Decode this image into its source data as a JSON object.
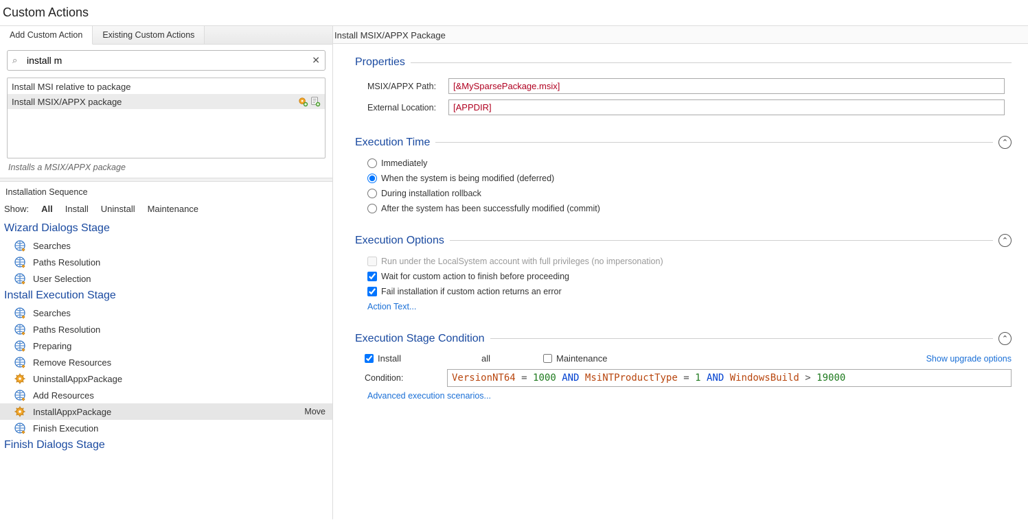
{
  "pageTitle": "Custom Actions",
  "tabs": {
    "add": "Add Custom Action",
    "existing": "Existing Custom Actions"
  },
  "search": {
    "value": "install m",
    "placeholder": ""
  },
  "suggestions": {
    "items": [
      {
        "label": "Install MSI relative to package",
        "selected": false
      },
      {
        "label": "Install MSIX/APPX package",
        "selected": true
      }
    ],
    "hint": "Installs a MSIX/APPX package"
  },
  "seqHeader": "Installation Sequence",
  "showRow": {
    "label": "Show:",
    "options": [
      "All",
      "Install",
      "Uninstall",
      "Maintenance"
    ],
    "active": "All"
  },
  "stages": {
    "wizard": {
      "title": "Wizard Dialogs Stage",
      "items": [
        "Searches",
        "Paths Resolution",
        "User Selection"
      ]
    },
    "exec": {
      "title": "Install Execution Stage",
      "items": [
        {
          "label": "Searches",
          "icon": "globe"
        },
        {
          "label": "Paths Resolution",
          "icon": "globe"
        },
        {
          "label": "Preparing",
          "icon": "globe"
        },
        {
          "label": "Remove Resources",
          "icon": "globe"
        },
        {
          "label": "UninstallAppxPackage",
          "icon": "gear"
        },
        {
          "label": "Add Resources",
          "icon": "globe"
        },
        {
          "label": "InstallAppxPackage",
          "icon": "gear",
          "selected": true,
          "move": "Move"
        },
        {
          "label": "Finish Execution",
          "icon": "globe"
        }
      ]
    },
    "finish": {
      "title": "Finish Dialogs Stage"
    }
  },
  "right": {
    "header": "Install MSIX/APPX Package",
    "sections": {
      "properties": {
        "title": "Properties",
        "pathLabel": "MSIX/APPX Path:",
        "pathValue": "[&MySparsePackage.msix]",
        "extLabel": "External Location:",
        "extValue": "[APPDIR]"
      },
      "execTime": {
        "title": "Execution Time",
        "options": [
          "Immediately",
          "When the system is being modified (deferred)",
          "During installation rollback",
          "After the system has been successfully modified (commit)"
        ],
        "selected": 1
      },
      "execOpts": {
        "title": "Execution Options",
        "optLocal": "Run under the LocalSystem account with full privileges (no impersonation)",
        "optWait": "Wait for custom action to finish before proceeding",
        "optFail": "Fail installation if custom action returns an error",
        "actionText": "Action Text..."
      },
      "stageCond": {
        "title": "Execution Stage Condition",
        "install": "Install",
        "mid": "all",
        "maint": "Maintenance",
        "upgrade": "Show upgrade options",
        "condLabel": "Condition:",
        "cond": {
          "tokens": [
            {
              "t": "var",
              "v": "VersionNT64"
            },
            {
              "t": "sp"
            },
            {
              "t": "op",
              "v": "="
            },
            {
              "t": "sp"
            },
            {
              "t": "num",
              "v": "1000"
            },
            {
              "t": "sp"
            },
            {
              "t": "kw",
              "v": "AND"
            },
            {
              "t": "sp"
            },
            {
              "t": "var",
              "v": "MsiNTProductType"
            },
            {
              "t": "sp"
            },
            {
              "t": "op",
              "v": "="
            },
            {
              "t": "sp"
            },
            {
              "t": "num",
              "v": "1"
            },
            {
              "t": "sp"
            },
            {
              "t": "kw",
              "v": "AND"
            },
            {
              "t": "sp"
            },
            {
              "t": "var",
              "v": "WindowsBuild"
            },
            {
              "t": "sp"
            },
            {
              "t": "op",
              "v": ">"
            },
            {
              "t": "sp"
            },
            {
              "t": "num",
              "v": "19000"
            }
          ]
        },
        "advanced": "Advanced execution scenarios..."
      }
    }
  }
}
